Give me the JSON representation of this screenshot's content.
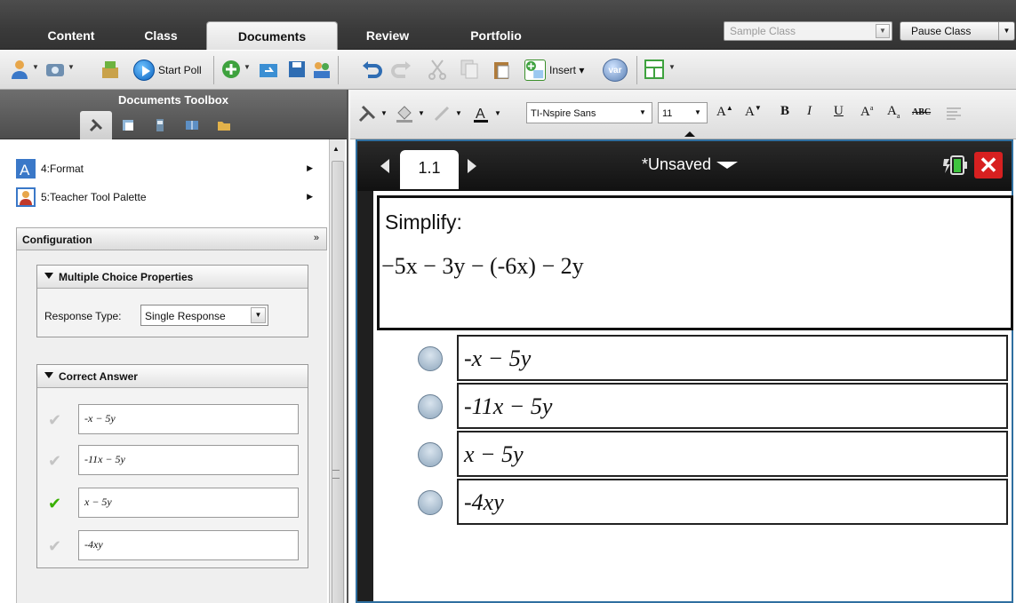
{
  "tabs": [
    "Content",
    "Class",
    "Documents",
    "Review",
    "Portfolio"
  ],
  "active_tab": "Documents",
  "class_select": {
    "placeholder": "Sample Class"
  },
  "pause_button": "Pause Class",
  "toolbar": {
    "start_poll": "Start Poll",
    "insert": "Insert",
    "var": "var"
  },
  "left_panel": {
    "title": "Documents Toolbox",
    "menu": [
      {
        "label": "4:Format"
      },
      {
        "label": "5:Teacher Tool Palette"
      }
    ],
    "configuration": "Configuration",
    "mc_properties": {
      "title": "Multiple Choice Properties",
      "response_type_label": "Response Type:",
      "response_type_value": "Single Response"
    },
    "correct_answer": {
      "title": "Correct Answer",
      "answers": [
        "-x − 5y",
        "-11x − 5y",
        "x − 5y",
        "-4xy"
      ],
      "correct_index": 2
    }
  },
  "format_bar": {
    "font": "TI-Nspire Sans",
    "size": "11",
    "bold": "B",
    "italic": "I",
    "underline": "U",
    "superscript": "A",
    "subscript": "A",
    "strikethrough": "ABC"
  },
  "document": {
    "page_tab": "1.1",
    "title": "*Unsaved",
    "question_title": "Simplify:",
    "question_expr": "−5x − 3y − (-6x) − 2y",
    "choices": [
      "-x − 5y",
      "-11x − 5y",
      "x − 5y",
      "-4xy"
    ]
  },
  "colors": {
    "top_bar": "#3f3f3f",
    "close_button": "#d72020",
    "check_correct": "#38b000",
    "doc_border": "#2f6fa0"
  }
}
